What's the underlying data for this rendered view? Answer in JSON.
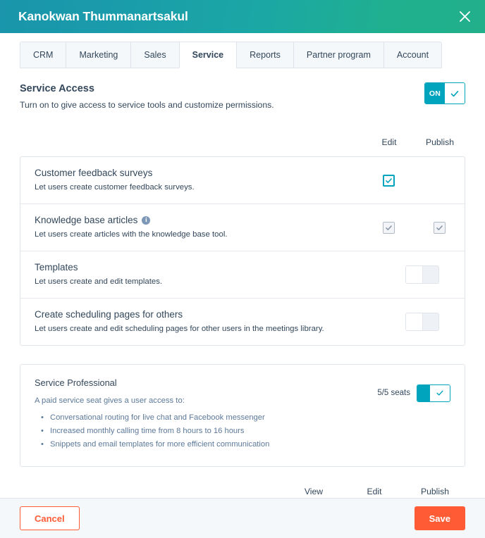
{
  "header": {
    "title": "Kanokwan Thummanartsakul",
    "close_icon": "close-icon"
  },
  "tabs": [
    {
      "label": "CRM",
      "active": false
    },
    {
      "label": "Marketing",
      "active": false
    },
    {
      "label": "Sales",
      "active": false
    },
    {
      "label": "Service",
      "active": true
    },
    {
      "label": "Reports",
      "active": false
    },
    {
      "label": "Partner program",
      "active": false
    },
    {
      "label": "Account",
      "active": false
    }
  ],
  "service_access": {
    "title": "Service Access",
    "subtitle": "Turn on to give access to service tools and customize permissions.",
    "toggle_label": "ON",
    "toggle_state": "on",
    "check_icon": "check-icon"
  },
  "column_headers_top": [
    "Edit",
    "Publish"
  ],
  "permissions": [
    {
      "title": "Customer feedback surveys",
      "description": "Let users create customer feedback surveys.",
      "has_info_icon": false,
      "control_type": "checkbox",
      "edit": "checked",
      "publish": "none"
    },
    {
      "title": "Knowledge base articles",
      "description": "Let users create articles with the knowledge base tool.",
      "has_info_icon": true,
      "info_icon_char": "i",
      "control_type": "checkbox",
      "edit": "disabled-checked",
      "publish": "disabled-checked"
    },
    {
      "title": "Templates",
      "description": "Let users create and edit templates.",
      "has_info_icon": false,
      "control_type": "toggle",
      "toggle_state": "off"
    },
    {
      "title": "Create scheduling pages for others",
      "description": "Let users create and edit scheduling pages for other users in the meetings library.",
      "has_info_icon": false,
      "control_type": "toggle",
      "toggle_state": "off"
    }
  ],
  "service_professional": {
    "title": "Service Professional",
    "intro": "A paid service seat gives a user access to:",
    "bullets": [
      "Conversational routing for live chat and Facebook messenger",
      "Increased monthly calling time from 8 hours to 16 hours",
      "Snippets and email templates for more efficient communication"
    ],
    "seats_label": "5/5 seats",
    "toggle_state": "on"
  },
  "column_headers_bottom": [
    "View",
    "Edit",
    "Publish"
  ],
  "footer": {
    "cancel_label": "Cancel",
    "save_label": "Save"
  },
  "colors": {
    "header_gradient_start": "#1a95ab",
    "header_gradient_end": "#22b08b",
    "accent_teal": "#00a4bd",
    "brand_orange": "#ff5c35",
    "text_primary": "#33475b",
    "text_muted": "#5c7999",
    "border": "#dfe3eb"
  }
}
